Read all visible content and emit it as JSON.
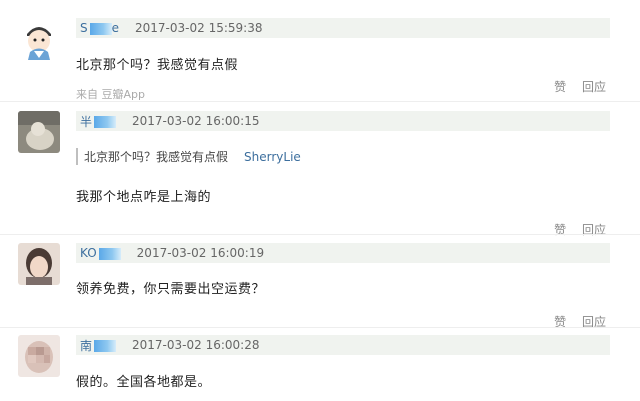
{
  "comments": [
    {
      "author_visible": "S",
      "author_tail": "e",
      "time": "2017-03-02 15:59:38",
      "text": "北京那个吗？我感觉有点假",
      "source": "来自 豆瓣App",
      "like": "赞",
      "reply": "回应"
    },
    {
      "author_visible": "半",
      "time": "2017-03-02 16:00:15",
      "quote_text": "北京那个吗？我感觉有点假",
      "quote_author": "SherryLie",
      "text": "我那个地点咋是上海的",
      "like": "赞",
      "reply": "回应"
    },
    {
      "author_visible": "KO",
      "time": "2017-03-02 16:00:19",
      "text": "领养免费，你只需要出空运费？",
      "like": "赞",
      "reply": "回应"
    },
    {
      "author_visible": "南",
      "time": "2017-03-02 16:00:28",
      "text": "假的。全国各地都是。"
    }
  ]
}
